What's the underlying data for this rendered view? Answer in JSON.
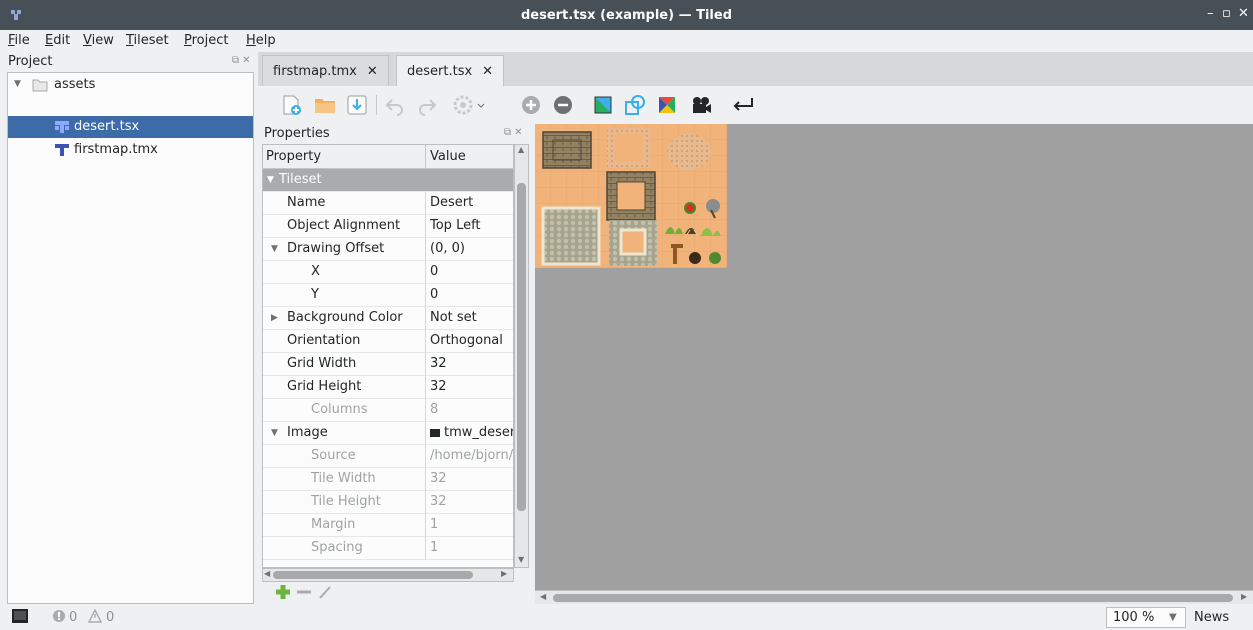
{
  "window": {
    "title": "desert.tsx (example) — Tiled",
    "controls": [
      "–",
      "▫",
      "✕"
    ]
  },
  "menu": [
    "File",
    "Edit",
    "View",
    "Tileset",
    "Project",
    "Help"
  ],
  "project": {
    "title": "Project",
    "items": [
      {
        "label": "assets",
        "type": "folder"
      },
      {
        "label": "desert.tsx",
        "type": "tileset",
        "selected": true
      },
      {
        "label": "firstmap.tmx",
        "type": "map"
      }
    ]
  },
  "tabs": [
    {
      "label": "firstmap.tmx",
      "close": "✕"
    },
    {
      "label": "desert.tsx",
      "close": "✕",
      "active": true
    }
  ],
  "toolbar": [
    "new-tileset-icon",
    "open-icon",
    "save-icon",
    "undo-icon",
    "redo-icon",
    "settings-icon",
    "add-tiles-icon",
    "remove-tiles-icon",
    "terrain-icon",
    "collision-icon",
    "wangset-icon",
    "animation-icon",
    "dynamic-wrap-icon"
  ],
  "properties": {
    "title": "Properties",
    "columns": {
      "property": "Property",
      "value": "Value"
    },
    "group": "Tileset",
    "rows": [
      {
        "k": "Name",
        "v": "Desert"
      },
      {
        "k": "Object Alignment",
        "v": "Top Left"
      },
      {
        "k": "Drawing Offset",
        "v": "(0, 0)"
      },
      {
        "k": "X",
        "v": "0"
      },
      {
        "k": "Y",
        "v": "0"
      },
      {
        "k": "Background Color",
        "v": "Not set"
      },
      {
        "k": "Orientation",
        "v": "Orthogonal"
      },
      {
        "k": "Grid Width",
        "v": "32"
      },
      {
        "k": "Grid Height",
        "v": "32"
      },
      {
        "k": "Columns",
        "v": "8"
      },
      {
        "k": "Image",
        "v": "tmw_deser"
      },
      {
        "k": "Source",
        "v": "/home/bjorn/"
      },
      {
        "k": "Tile Width",
        "v": "32"
      },
      {
        "k": "Tile Height",
        "v": "32"
      },
      {
        "k": "Margin",
        "v": "1"
      },
      {
        "k": "Spacing",
        "v": "1"
      }
    ]
  },
  "status": {
    "errors": "0",
    "warnings": "0",
    "zoom": "100 %",
    "news": "News"
  },
  "colors": {
    "titlebar": "#475057",
    "selection": "#3d6ba8",
    "sand": "#f2b37b",
    "canvas": "#a0a0a0"
  }
}
